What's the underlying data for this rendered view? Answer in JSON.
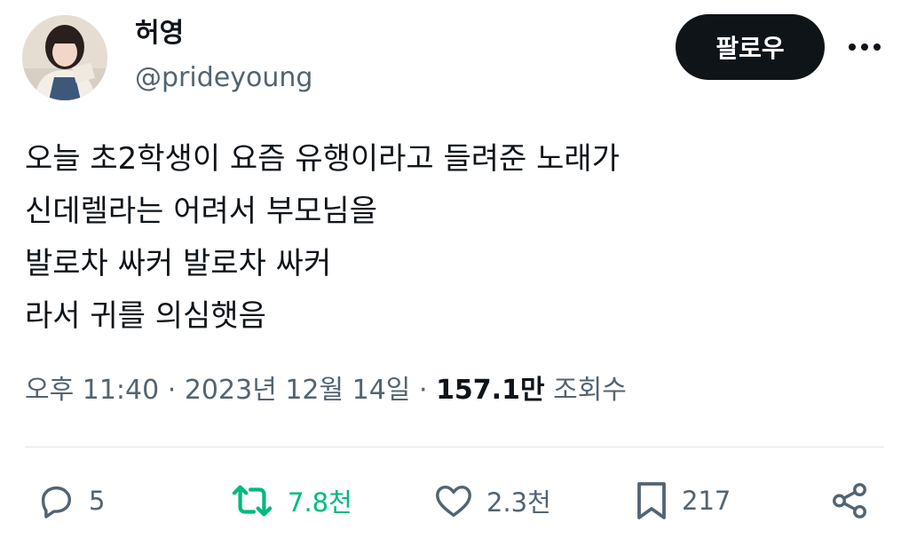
{
  "author": {
    "display_name": "허영",
    "handle": "@prideyoung"
  },
  "header": {
    "follow_label": "팔로우",
    "more_icon": "more-dots-icon"
  },
  "tweet": {
    "lines": [
      "오늘 초2학생이 요즘 유행이라고 들려준 노래가",
      "신데렐라는 어려서 부모님을",
      "발로차 싸커 발로차 싸커",
      "라서 귀를 의심햇음"
    ]
  },
  "meta": {
    "time": "오후 11:40",
    "separator": "·",
    "date": "2023년 12월 14일",
    "views_count": "157.1만",
    "views_label": "조회수"
  },
  "actions": {
    "reply_count": "5",
    "retweet_count": "7.8천",
    "like_count": "2.3천",
    "bookmark_count": "217",
    "icons": [
      "reply-icon",
      "retweet-icon",
      "like-icon",
      "bookmark-icon",
      "share-icon"
    ]
  },
  "colors": {
    "text": "#0f1419",
    "secondary": "#536471",
    "retweet_green": "#00ba7c",
    "button_bg": "#0f1419"
  }
}
